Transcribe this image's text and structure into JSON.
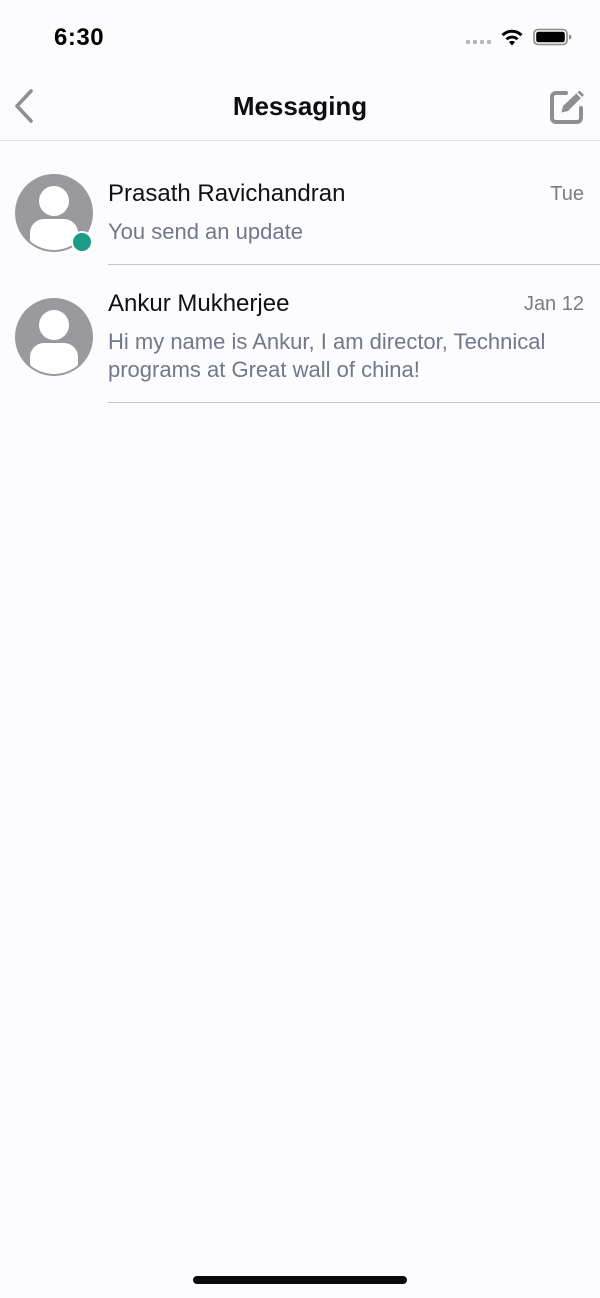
{
  "status_bar": {
    "time": "6:30",
    "icons": [
      "signal-dots-icon",
      "wifi-icon",
      "battery-icon"
    ]
  },
  "nav": {
    "title": "Messaging",
    "back_icon": "chevron-left-icon",
    "compose_icon": "compose-icon"
  },
  "conversations": [
    {
      "name": "Prasath Ravichandran",
      "date": "Tue",
      "preview": "You send an update",
      "online": true
    },
    {
      "name": "Ankur Mukherjee",
      "date": "Jan 12",
      "preview": "Hi my name is Ankur, I am director, Technical programs at Great wall of china!",
      "online": false
    }
  ],
  "colors": {
    "background": "#fcfbfd",
    "icon_gray": "#8e8e93",
    "online_green": "#1a9c86",
    "preview_text": "#72788a",
    "date_text": "#7b7c80"
  }
}
